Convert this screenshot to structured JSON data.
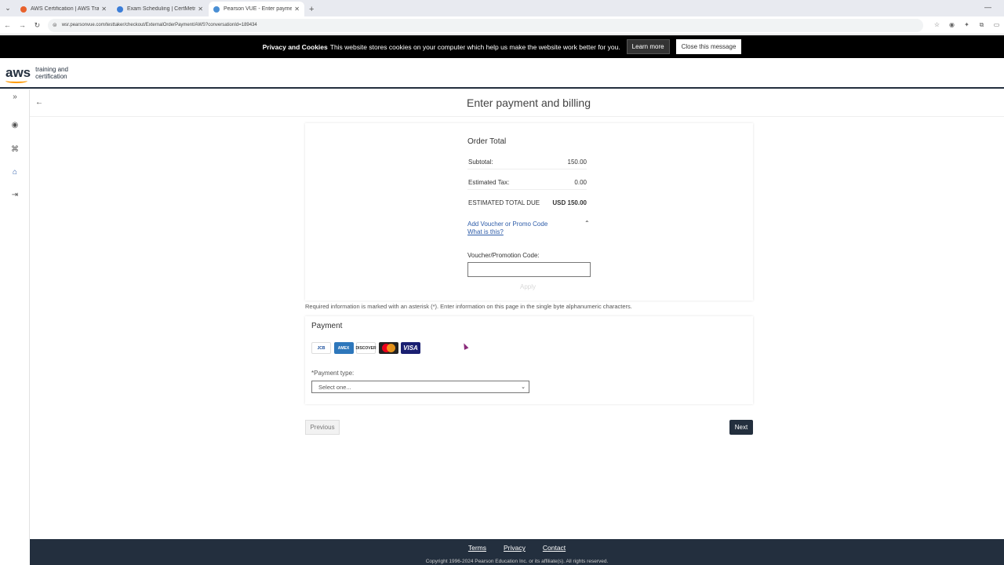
{
  "browser": {
    "tabs": [
      {
        "title": "AWS Certification | AWS Traini",
        "favicon_color": "#e8612c",
        "active": false
      },
      {
        "title": "Exam Scheduling | CertMetrics",
        "favicon_color": "#3b7dd8",
        "active": false
      },
      {
        "title": "Pearson VUE - Enter payment a",
        "favicon_color": "#4a8fd4",
        "active": true
      }
    ],
    "url": "wsr.pearsonvue.com/testtaker/checkout/ExternalOrderPayment/AWS?conversationId=189434"
  },
  "cookie_banner": {
    "heading": "Privacy and Cookies",
    "text": "This website stores cookies on your computer which help us make the website work better for you.",
    "learn_more": "Learn more",
    "close": "Close this message"
  },
  "aws_header": {
    "logo_text": "aws",
    "tagline_line1": "training and",
    "tagline_line2": "certification"
  },
  "page": {
    "title": "Enter payment and billing"
  },
  "order": {
    "heading": "Order Total",
    "subtotal_label": "Subtotal:",
    "subtotal_value": "150.00",
    "tax_label": "Estimated Tax:",
    "tax_value": "0.00",
    "total_label": "ESTIMATED TOTAL DUE",
    "total_value": "USD 150.00",
    "promo_link": "Add Voucher or Promo Code",
    "promo_help": "What is this?",
    "voucher_label": "Voucher/Promotion Code:",
    "voucher_value": "",
    "apply": "Apply"
  },
  "required_note": "Required information is marked with an asterisk (*). Enter information on this page in the single byte alphanumeric characters.",
  "payment": {
    "heading": "Payment",
    "cards": [
      "JCB",
      "AMEX",
      "DISCOVER",
      "MasterCard",
      "VISA"
    ],
    "type_label": "*Payment type:",
    "type_selected": "Select one..."
  },
  "nav": {
    "previous": "Previous",
    "next": "Next"
  },
  "footer": {
    "links": [
      "Terms",
      "Privacy",
      "Contact"
    ],
    "copyright": "Copyright 1996-2024 Pearson Education Inc. or its affiliate(s). All rights reserved."
  }
}
